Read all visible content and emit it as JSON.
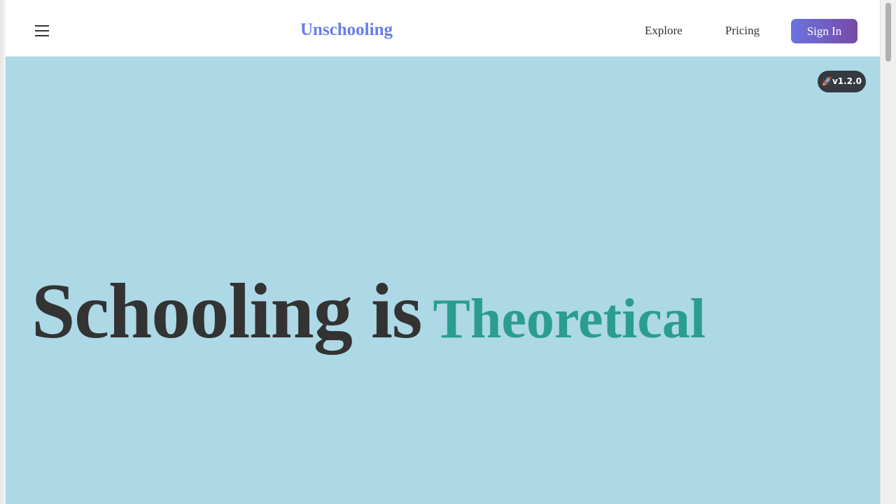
{
  "header": {
    "brand": "Unschooling",
    "nav": {
      "explore": "Explore",
      "pricing": "Pricing"
    },
    "signin_label": "Sign In"
  },
  "hero": {
    "version_badge": "🚀v1.2.0",
    "title_static": "Schooling is",
    "title_dynamic": "Theoretical"
  },
  "colors": {
    "brand": "#667eea",
    "hero_bg": "#add8e6",
    "accent_text": "#2a9d8f",
    "badge_bg": "#343a40"
  },
  "icons": {
    "menu": "hamburger-menu-icon"
  }
}
